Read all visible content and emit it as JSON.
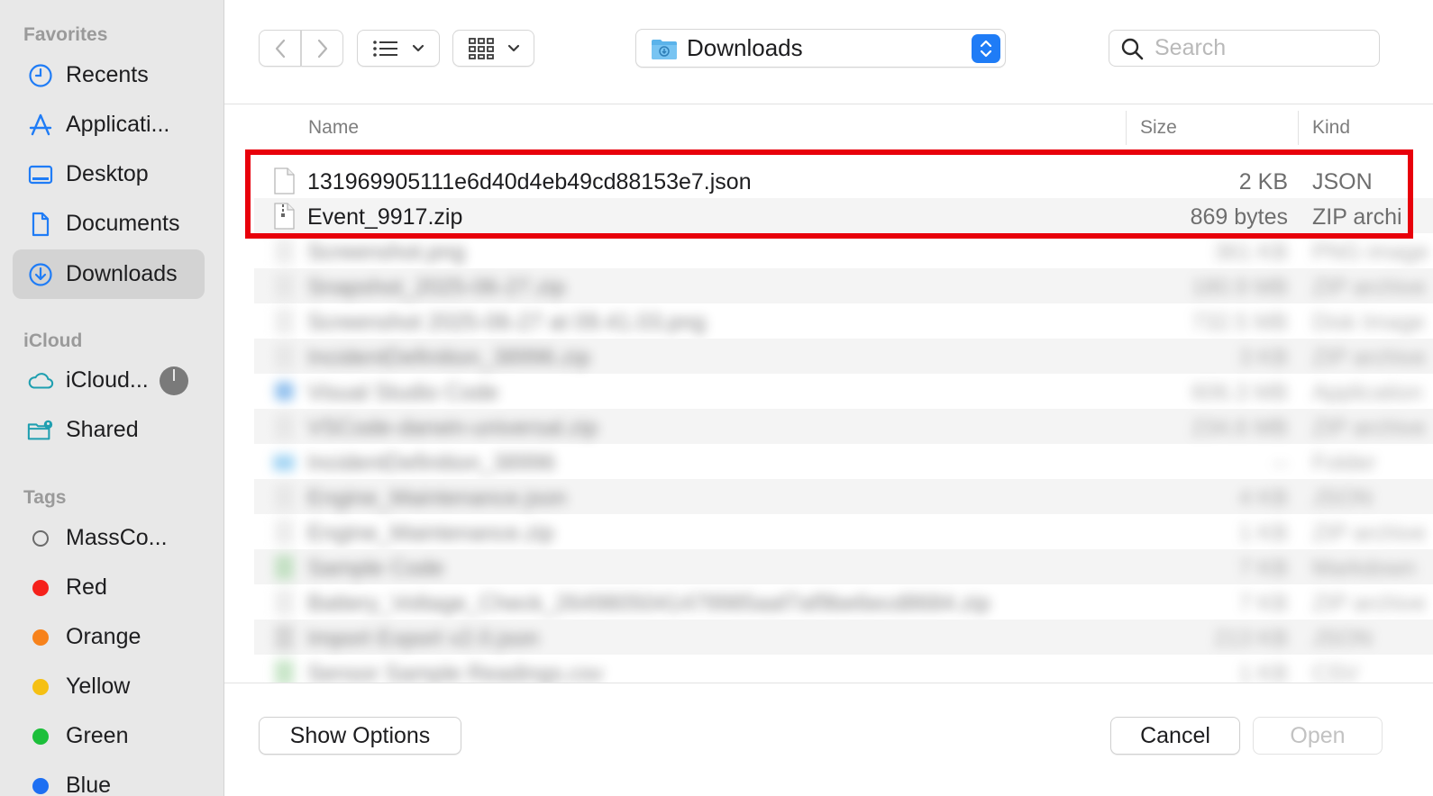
{
  "sidebar": {
    "favorites_heading": "Favorites",
    "favorites": [
      {
        "label": "Recents",
        "icon": "clock-icon"
      },
      {
        "label": "Applicati...",
        "icon": "applications-icon"
      },
      {
        "label": "Desktop",
        "icon": "desktop-icon"
      },
      {
        "label": "Documents",
        "icon": "document-icon"
      },
      {
        "label": "Downloads",
        "icon": "downloads-icon",
        "selected": true
      }
    ],
    "icloud_heading": "iCloud",
    "icloud": [
      {
        "label": "iCloud...",
        "icon": "cloud-icon"
      },
      {
        "label": "Shared",
        "icon": "shared-folder-icon"
      }
    ],
    "tags_heading": "Tags",
    "tags": [
      {
        "label": "MassCo...",
        "color": ""
      },
      {
        "label": "Red",
        "color": "#f5211b"
      },
      {
        "label": "Orange",
        "color": "#f7821b"
      },
      {
        "label": "Yellow",
        "color": "#f5c013"
      },
      {
        "label": "Green",
        "color": "#1cbf3a"
      },
      {
        "label": "Blue",
        "color": "#1d6ff2"
      }
    ]
  },
  "toolbar": {
    "back_icon": "chevron-left-icon",
    "forward_icon": "chevron-right-icon",
    "view_list_icon": "list-view-icon",
    "view_grid_icon": "grid-view-icon",
    "location": "Downloads",
    "search_placeholder": "Search"
  },
  "columns": {
    "name": "Name",
    "size": "Size",
    "kind": "Kind"
  },
  "files": [
    {
      "name": "131969905111e6d40d4eb49cd88153e7.json",
      "size": "2 KB",
      "kind": "JSON",
      "icon": "document-icon"
    },
    {
      "name": "Event_9917.zip",
      "size": "869 bytes",
      "kind": "ZIP archi",
      "icon": "zip-file-icon"
    }
  ],
  "blurred_rows": [
    {
      "name": "Screenshot.png",
      "size": "361 KB",
      "kind": "PNG image"
    },
    {
      "name": "Snapshot_2025-06-27.zip",
      "size": "180.9 MB",
      "kind": "ZIP archive"
    },
    {
      "name": "Screenshot 2025-06-27 at 09.41.03.png",
      "size": "732.5 MB",
      "kind": "Disk Image"
    },
    {
      "name": "IncidentDefinition_38996.zip",
      "size": "3 KB",
      "kind": "ZIP archive"
    },
    {
      "name": "Visual Studio Code",
      "size": "606.3 MB",
      "kind": "Application"
    },
    {
      "name": "VSCode-darwin-universal.zip",
      "size": "234.6 MB",
      "kind": "ZIP archive"
    },
    {
      "name": "IncidentDefinition_38996",
      "size": "--",
      "kind": "Folder"
    },
    {
      "name": "Engine_Maintenance.json",
      "size": "4 KB",
      "kind": "JSON"
    },
    {
      "name": "Engine_Maintenance.zip",
      "size": "1 KB",
      "kind": "ZIP archive"
    },
    {
      "name": "Sample Code",
      "size": "7 KB",
      "kind": "Markdown"
    },
    {
      "name": "Battery_Voltage_Check_2649805041479985aaf7af9be6ecd8684.zip",
      "size": "7 KB",
      "kind": "ZIP archive"
    },
    {
      "name": "Import Export v2.0.json",
      "size": "213 KB",
      "kind": "JSON"
    },
    {
      "name": "Sensor Sample Readings.csv",
      "size": "1 KB",
      "kind": "CSV"
    }
  ],
  "footer": {
    "show_options": "Show Options",
    "cancel": "Cancel",
    "open": "Open"
  },
  "colors": {
    "accent": "#1f7cf6",
    "highlight": "#e8000b"
  }
}
